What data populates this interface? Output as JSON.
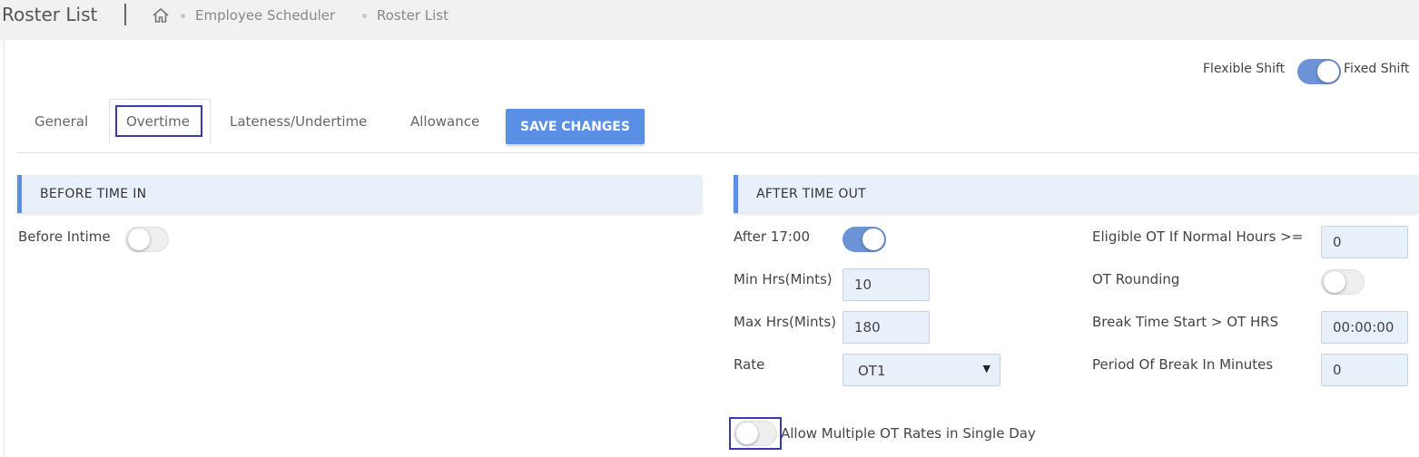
{
  "header": {
    "title": "Roster List",
    "breadcrumb": [
      "Employee Scheduler",
      "Roster List"
    ]
  },
  "shift_switch": {
    "left_label": "Flexible Shift",
    "right_label": "Fixed Shift",
    "on": true
  },
  "tabs": [
    {
      "label": "General",
      "active": false
    },
    {
      "label": "Overtime",
      "active": true
    },
    {
      "label": "Lateness/Undertime",
      "active": false
    },
    {
      "label": "Allowance",
      "active": false
    }
  ],
  "save_button_label": "SAVE CHANGES",
  "before_section": {
    "title": "BEFORE TIME IN",
    "before_intime_label": "Before Intime",
    "before_intime_on": false
  },
  "after_section": {
    "title": "AFTER TIME OUT",
    "after_label": "After 17:00",
    "after_on": true,
    "min_label": "Min Hrs(Mints)",
    "min_value": "10",
    "max_label": "Max Hrs(Mints)",
    "max_value": "180",
    "rate_label": "Rate",
    "rate_value": "OT1",
    "eligible_label": "Eligible OT If Normal Hours >=",
    "eligible_value": "0",
    "rounding_label": "OT Rounding",
    "rounding_on": false,
    "break_start_label": "Break Time Start > OT HRS",
    "break_start_value": "00:00:00",
    "break_period_label": "Period Of Break In Minutes",
    "break_period_value": "0",
    "multi_rates_label": "Allow Multiple OT Rates in Single Day",
    "multi_rates_on": false
  },
  "colors": {
    "accent": "#5b8fe6",
    "toggle_on": "#6b93d6",
    "field_bg": "#e8f0fa",
    "highlight_box": "#3a3ab0"
  }
}
